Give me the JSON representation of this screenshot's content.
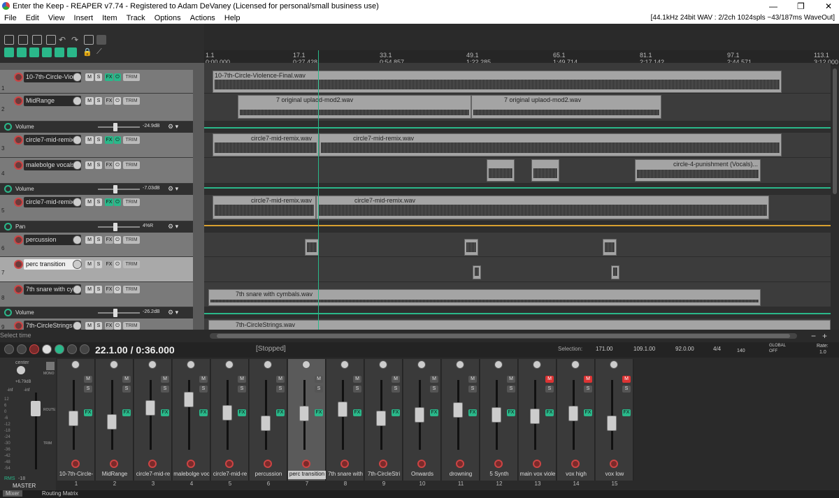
{
  "window": {
    "title": "Enter the Keep - REAPER v7.74 - Registered to Adam DeVaney (Licensed for personal/small business use)",
    "status": "[44.1kHz 24bit WAV : 2/2ch 1024spls ~43/187ms WaveOut]"
  },
  "menu": [
    "File",
    "Edit",
    "View",
    "Insert",
    "Item",
    "Track",
    "Options",
    "Actions",
    "Help"
  ],
  "ruler": [
    {
      "bar": "1.1",
      "time": "0:00.000"
    },
    {
      "bar": "17.1",
      "time": "0:27.428"
    },
    {
      "bar": "33.1",
      "time": "0:54.857"
    },
    {
      "bar": "49.1",
      "time": "1:22.285"
    },
    {
      "bar": "65.1",
      "time": "1:49.714"
    },
    {
      "bar": "81.1",
      "time": "2:17.142"
    },
    {
      "bar": "97.1",
      "time": "2:44.571"
    },
    {
      "bar": "113.1",
      "time": "3:12.000"
    }
  ],
  "tracks": [
    {
      "num": "1",
      "name": "10-7th-Circle-Viole",
      "items": [
        {
          "label": "10-7th-Circle-Violence-Final.wav"
        }
      ]
    },
    {
      "num": "2",
      "name": "MidRange",
      "items": [
        {
          "label": "7 original uplaod-mod2.wav"
        },
        {
          "label": "7 original uplaod-mod2.wav"
        }
      ]
    },
    {
      "num": "3",
      "name": "circle7-mid-remix",
      "items": [
        {
          "label": "circle7-mid-remix.wav"
        },
        {
          "label": "circle7-mid-remix.wav"
        }
      ]
    },
    {
      "num": "4",
      "name": "malebolge vocals",
      "items": [
        {
          "label": "circle-4-punishment (Vocals)..."
        }
      ]
    },
    {
      "num": "5",
      "name": "circle7-mid-remix",
      "items": [
        {
          "label": "circle7-mid-remix.wav"
        },
        {
          "label": "circle7-mid-remix.wav"
        }
      ]
    },
    {
      "num": "6",
      "name": "percussion",
      "items": []
    },
    {
      "num": "7",
      "name": "perc transition",
      "items": []
    },
    {
      "num": "8",
      "name": "7th snare with cym",
      "items": [
        {
          "label": "7th snare with cymbals.wav"
        }
      ]
    },
    {
      "num": "9",
      "name": "7th-CircleStrings",
      "items": [
        {
          "label": "7th-CircleStrings.wav"
        }
      ]
    }
  ],
  "envelopes": [
    {
      "label": "Volume",
      "value": "-24.9dB"
    },
    {
      "label": "Volume",
      "value": "-7.03dB"
    },
    {
      "label": "Pan",
      "value": "4%R"
    },
    {
      "label": "Volume",
      "value": "-26.2dB"
    }
  ],
  "buttons": {
    "mute": "M",
    "solo": "S",
    "fx": "FX",
    "trim": "TRIM"
  },
  "status_hint": "Select time",
  "transport": {
    "time": "22.1.00 / 0:36.000",
    "state": "[Stopped]",
    "selection_label": "Selection:",
    "sel_start": "171.00",
    "sel_end": "109.1.00",
    "sel_len": "92.0.00",
    "timesig": "4/4",
    "bpm": "140",
    "global": "GLOBAL",
    "global_state": "OFF",
    "rate_label": "Rate:",
    "rate": "1.0"
  },
  "mixer": {
    "master_label": "MASTER",
    "center": "center",
    "master_db": "+6.79dB",
    "master_scale": [
      "-inf",
      "-inf"
    ],
    "db_scale": [
      "12",
      "6",
      "0",
      "-6",
      "-12",
      "-18",
      "-24",
      "-30",
      "-36",
      "-42",
      "-48",
      "-54"
    ],
    "rms": "RMS",
    "rms_val": "-18",
    "side_buttons": [
      "MONO",
      "ROUTE",
      "TRIM"
    ],
    "channels": [
      {
        "num": "1",
        "name": "10-7th-Circle-",
        "level": 0.45,
        "mute": false
      },
      {
        "num": "2",
        "name": "MidRange",
        "level": 0.4,
        "mute": false
      },
      {
        "num": "3",
        "name": "circle7-mid-re",
        "level": 0.6,
        "mute": false
      },
      {
        "num": "4",
        "name": "malebolge voc",
        "level": 0.72,
        "mute": false
      },
      {
        "num": "5",
        "name": "circle7-mid-re",
        "level": 0.53,
        "mute": false
      },
      {
        "num": "6",
        "name": "percussion",
        "level": 0.38,
        "mute": false
      },
      {
        "num": "7",
        "name": "perc transition",
        "level": 0.52,
        "mute": false
      },
      {
        "num": "8",
        "name": "7th snare with",
        "level": 0.58,
        "mute": false
      },
      {
        "num": "9",
        "name": "7th-CircleStri",
        "level": 0.45,
        "mute": false
      },
      {
        "num": "10",
        "name": "Onwards",
        "level": 0.5,
        "mute": false
      },
      {
        "num": "11",
        "name": "drowning",
        "level": 0.57,
        "mute": false
      },
      {
        "num": "12",
        "name": "5 Synth",
        "level": 0.5,
        "mute": false
      },
      {
        "num": "13",
        "name": "main vox viole",
        "level": 0.48,
        "mute": true
      },
      {
        "num": "14",
        "name": "vox high",
        "level": 0.52,
        "mute": true
      },
      {
        "num": "15",
        "name": "vox low",
        "level": 0.38,
        "mute": true
      }
    ]
  },
  "tabs": {
    "mixer": "Mixer",
    "routing": "Routing Matrix"
  }
}
